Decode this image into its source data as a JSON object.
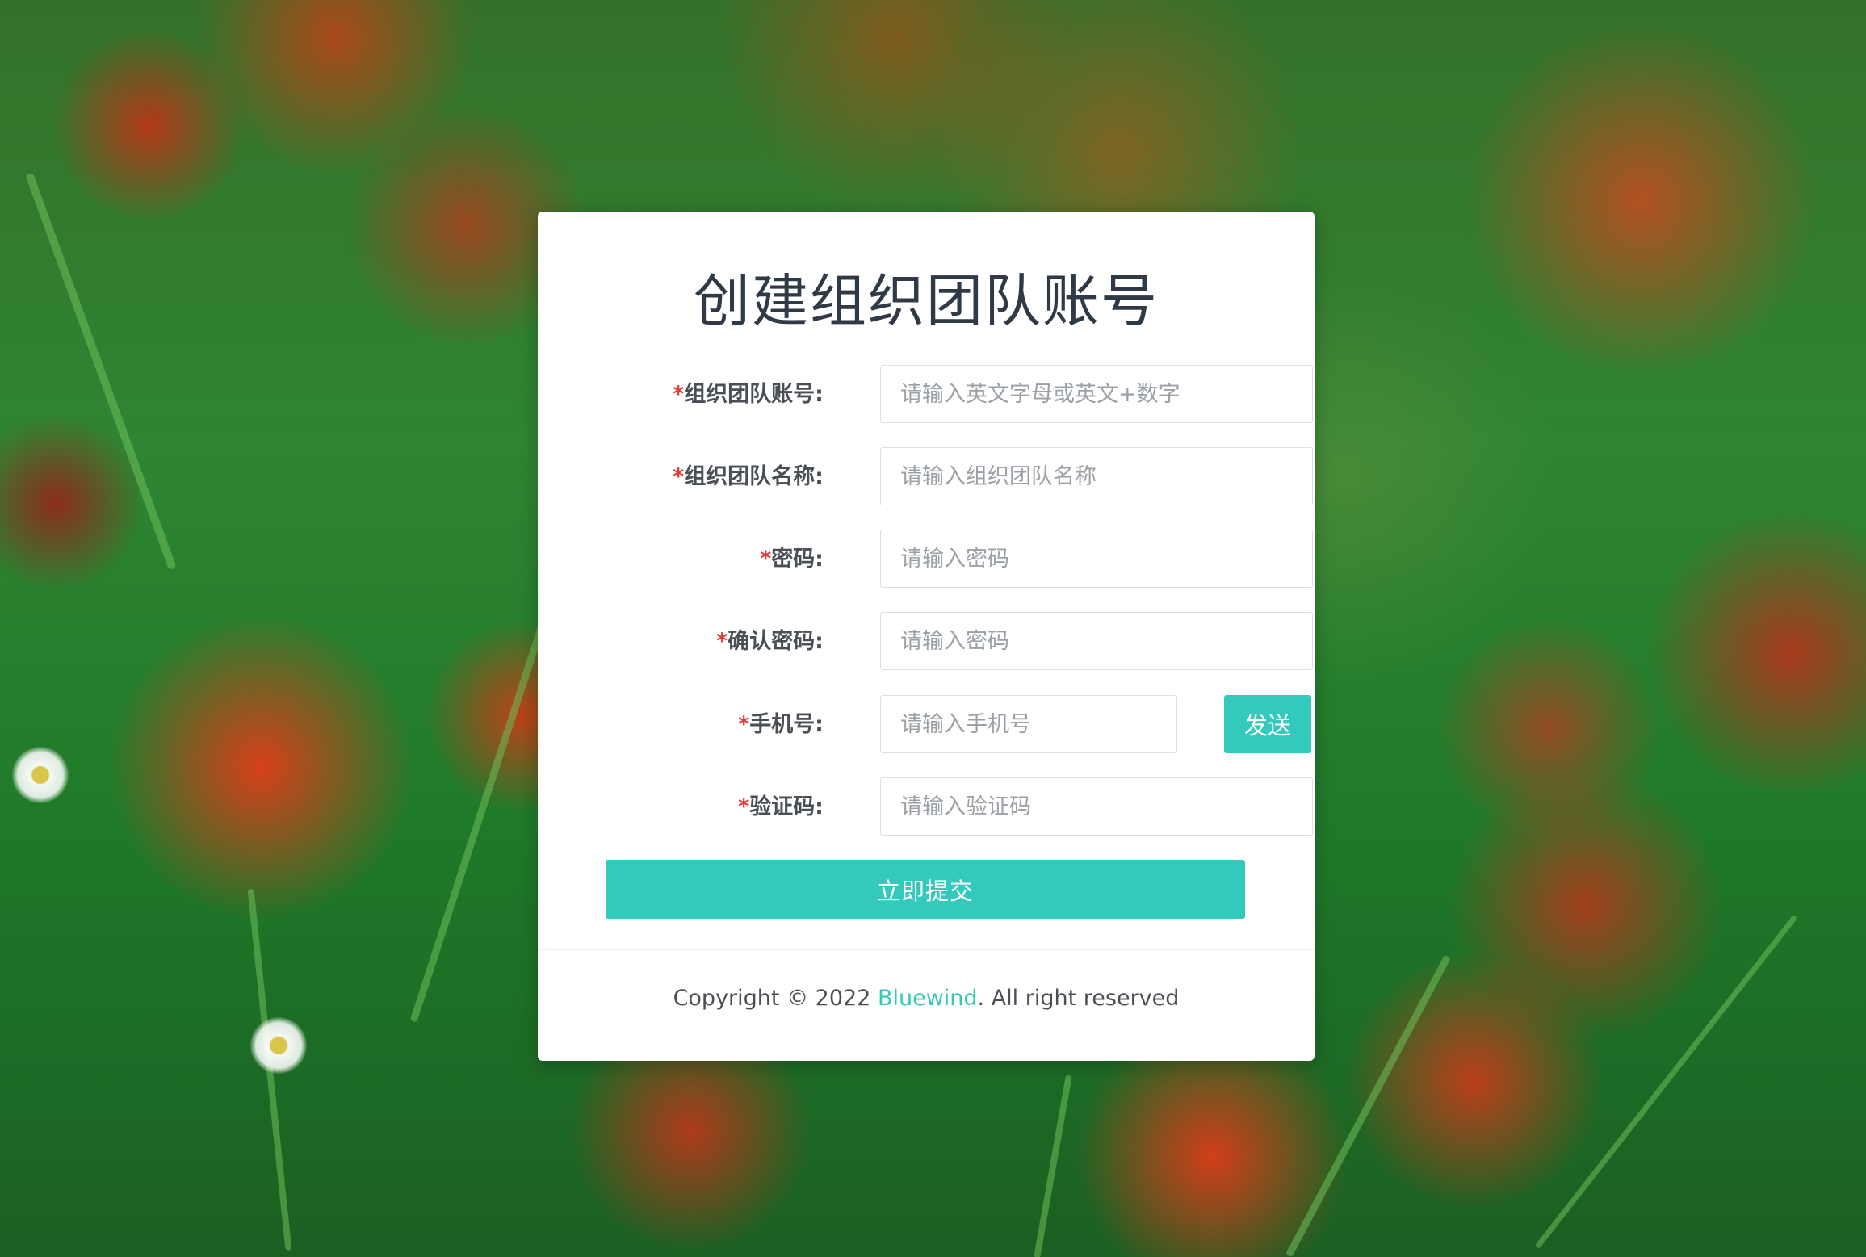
{
  "page": {
    "title": "创建组织团队账号"
  },
  "form": {
    "required_mark": "*",
    "fields": [
      {
        "label": "组织团队账号:",
        "placeholder": "请输入英文字母或英文+数字",
        "value": ""
      },
      {
        "label": "组织团队名称:",
        "placeholder": "请输入组织团队名称",
        "value": ""
      },
      {
        "label": "密码:",
        "placeholder": "请输入密码",
        "value": ""
      },
      {
        "label": "确认密码:",
        "placeholder": "请输入密码",
        "value": ""
      },
      {
        "label": "手机号:",
        "placeholder": "请输入手机号",
        "value": ""
      },
      {
        "label": "验证码:",
        "placeholder": "请输入验证码",
        "value": ""
      }
    ],
    "send_button_label": "发送",
    "submit_button_label": "立即提交"
  },
  "footer": {
    "copyright_prefix": "Copyright © 2022 ",
    "brand_link": "Bluewind",
    "copyright_suffix": ". All right reserved"
  },
  "colors": {
    "accent": "#33c9bd",
    "required": "#e53935",
    "card_background": "#ffffff",
    "title_text": "#2f3a46"
  }
}
